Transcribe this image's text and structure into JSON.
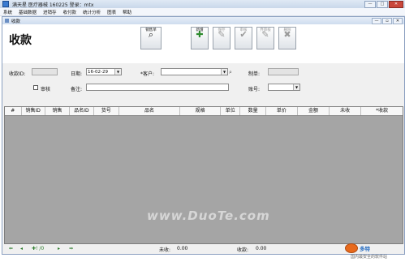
{
  "window": {
    "title": "满天星 医疗器械 160225  登录：mtx"
  },
  "menu": [
    "系统",
    "基础数据",
    "进销存",
    "收付款",
    "统计分析",
    "图表",
    "帮助"
  ],
  "subwindow": {
    "title": "收款"
  },
  "page": {
    "title": "收款"
  },
  "toolbar": {
    "sales_label": "销售单",
    "buttons": [
      {
        "label": "新增",
        "icon": "add-icon",
        "glyph": "✚",
        "enabled": true
      },
      {
        "label": "保存",
        "icon": "save-icon",
        "glyph": "✎",
        "enabled": false
      },
      {
        "label": "审核",
        "icon": "check-icon",
        "glyph": "✔",
        "enabled": false
      },
      {
        "label": "弃审核",
        "icon": "unaudit-icon",
        "glyph": "✎",
        "enabled": false
      },
      {
        "label": "删除",
        "icon": "delete-icon",
        "glyph": "✖",
        "enabled": false
      }
    ]
  },
  "form": {
    "receipt_id_label": "收款ID:",
    "date_label": "日期:",
    "date_value": "16-02-29",
    "customer_label": "*客户:",
    "customer_value": "",
    "amount_label": "制单:",
    "audit_label": "审核",
    "note_label": "备注:",
    "account_label": "账号:"
  },
  "grid": {
    "columns": [
      "#",
      "销售ID",
      "销售",
      "品名ID",
      "货号",
      "品名",
      "规格",
      "单位",
      "数量",
      "单价",
      "金额",
      "未收",
      "*收款"
    ]
  },
  "watermark": "www.DuoTe.com",
  "footer": {
    "record_count": "0",
    "unpaid_label": "未收:",
    "unpaid_value": "0.00",
    "received_label": "收款:",
    "received_value": "0.00"
  },
  "logo": {
    "text": "多特",
    "subtext": "国内最安全的软件站"
  }
}
